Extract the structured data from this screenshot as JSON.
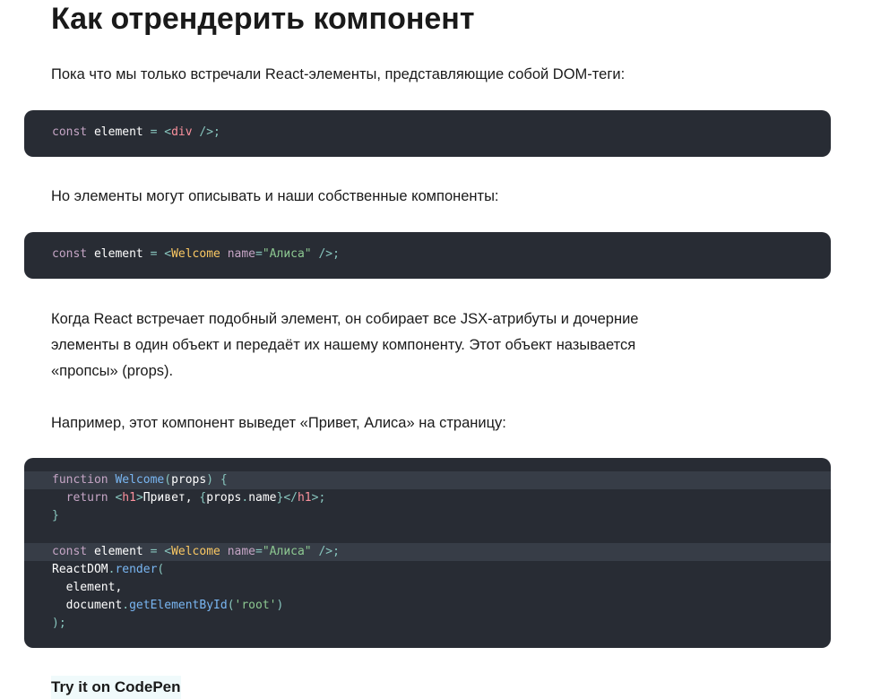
{
  "heading": "Как отрендерить компонент",
  "p1": "Пока что мы только встречали React-элементы, представляющие собой DOM-теги:",
  "code1": {
    "kw": "const",
    "var": " element ",
    "eq": "=",
    "lt": " <",
    "tag": "div",
    "end": " />;"
  },
  "p2": "Но элементы могут описывать и наши собственные компоненты:",
  "code2": {
    "kw": "const",
    "var": " element ",
    "eq": "=",
    "lt": " <",
    "comp": "Welcome",
    "attr": " name",
    "attr_eq": "=",
    "str": "\"Алиса\"",
    "end": " />;"
  },
  "p3": [
    "Когда React встречает подобный элемент, он собирает все JSX-атрибуты и дочерние",
    "элементы в один объект и передаёт их нашему компоненту. Этот объект называется",
    "«пропсы» (props)."
  ],
  "p4": "Например, этот компонент выведет «Привет, Алиса» на страницу:",
  "code3": {
    "l1": {
      "kw": "function",
      "fn": " Welcome",
      "open": "(",
      "arg": "props",
      "close": ")",
      "brace": " {"
    },
    "l2": {
      "indent": "  ",
      "kw": "return",
      "lt": " <",
      "tag": "h1",
      "gt": ">",
      "text": "Привет, ",
      "ob": "{",
      "obj": "props",
      "dot": ".",
      "prop": "name",
      "cb": "}",
      "clt": "</",
      "ctag": "h1",
      "cgt": ">",
      "semi": ";"
    },
    "l3": {
      "brace": "}"
    },
    "l5": {
      "kw": "const",
      "var": " element ",
      "eq": "=",
      "lt": " <",
      "comp": "Welcome",
      "attr": " name",
      "attr_eq": "=",
      "str": "\"Алиса\"",
      "end": " />;"
    },
    "l6": {
      "obj": "ReactDOM",
      "dot": ".",
      "fn": "render",
      "open": "("
    },
    "l7": {
      "text": "  element,"
    },
    "l8": {
      "indent": "  ",
      "obj": "document",
      "dot": ".",
      "fn": "getElementById",
      "open": "(",
      "str": "'root'",
      "close": ")"
    },
    "l9": {
      "close": ");"
    }
  },
  "cta": "Try it on CodePen",
  "colors": {
    "code_bg": "#282c34",
    "code_highlight": "#373d47",
    "keyword": "#c5a5c5",
    "tag": "#fc929e",
    "component": "#fac863",
    "string": "#8dc891",
    "function": "#79b6f2"
  }
}
